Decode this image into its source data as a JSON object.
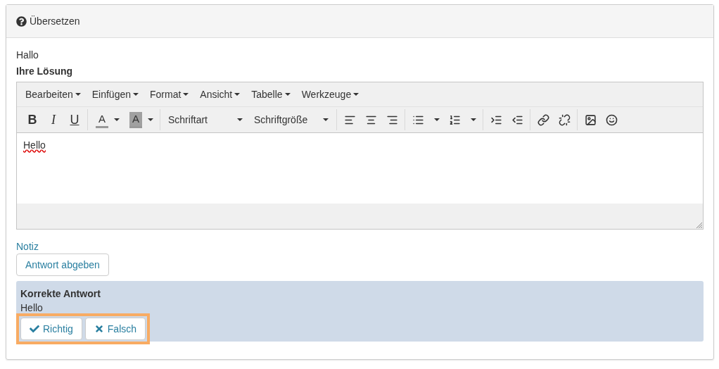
{
  "panel": {
    "title": "Übersetzen"
  },
  "prompt": "Hallo",
  "solution_label": "Ihre Lösung",
  "editor": {
    "menus": [
      {
        "label": "Bearbeiten"
      },
      {
        "label": "Einfügen"
      },
      {
        "label": "Format"
      },
      {
        "label": "Ansicht"
      },
      {
        "label": "Tabelle"
      },
      {
        "label": "Werkzeuge"
      }
    ],
    "format_buttons": [
      "B",
      "I",
      "U"
    ],
    "color_buttons": [
      "A",
      "A"
    ],
    "font_selects": [
      {
        "label": "Schriftart"
      },
      {
        "label": "Schriftgröße"
      }
    ],
    "content": {
      "text": "Hello",
      "misspelled": true
    }
  },
  "note_link": "Notiz",
  "submit_button": "Antwort abgeben",
  "correct_answer": {
    "title": "Korrekte Antwort",
    "text": "Hello",
    "highlighted": true,
    "buttons": [
      {
        "kind": "right",
        "label": "Richtig"
      },
      {
        "kind": "wrong",
        "label": "Falsch"
      }
    ]
  }
}
